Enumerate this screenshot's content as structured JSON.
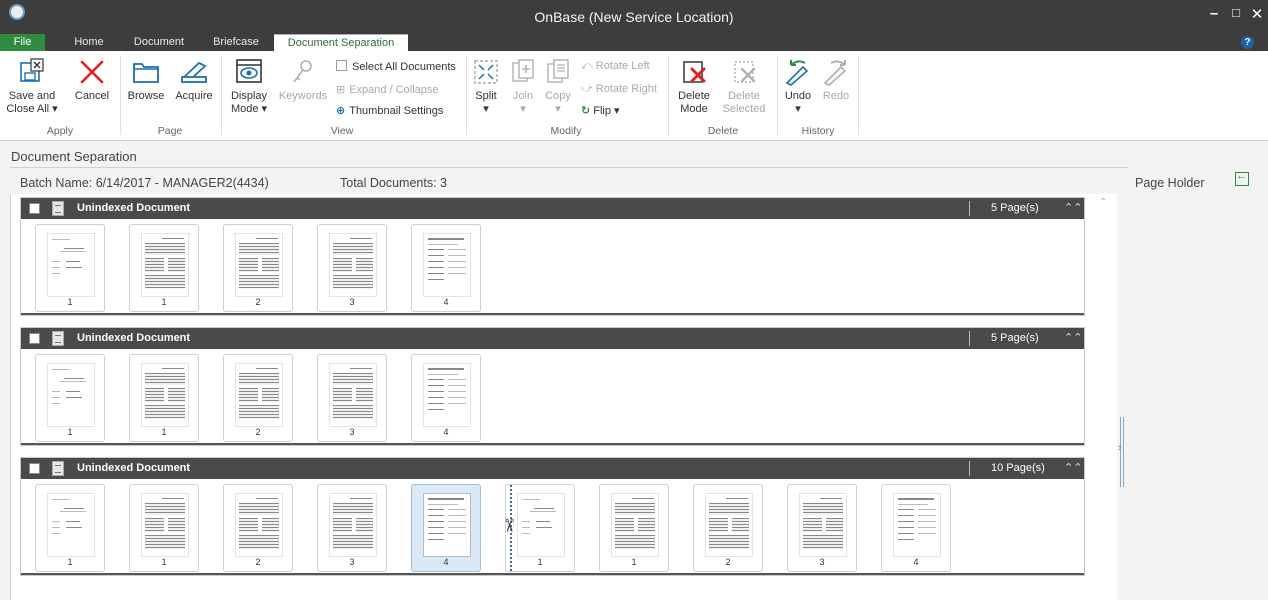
{
  "window": {
    "title": "OnBase (New Service Location)",
    "minimize": "–",
    "maximize": "□",
    "close": "✕",
    "help": "?"
  },
  "tabs": [
    {
      "label": "File"
    },
    {
      "label": "Home"
    },
    {
      "label": "Document"
    },
    {
      "label": "Briefcase"
    },
    {
      "label": "Document Separation"
    }
  ],
  "ribbon": {
    "apply": {
      "label": "Apply",
      "save_close_all": "Save and\nClose All ▾",
      "cancel": "Cancel"
    },
    "page": {
      "label": "Page",
      "browse": "Browse",
      "acquire": "Acquire"
    },
    "view": {
      "label": "View",
      "display_mode": "Display\nMode ▾",
      "keywords": "Keywords",
      "select_all": "Select All Documents",
      "expand_collapse": "Expand / Collapse",
      "thumbnail_settings": "Thumbnail Settings"
    },
    "modify": {
      "label": "Modify",
      "split": "Split\n▾",
      "join": "Join\n▾",
      "copy": "Copy\n▾",
      "rotate_left": "Rotate Left",
      "rotate_right": "Rotate Right",
      "flip": "Flip ▾"
    },
    "delete": {
      "label": "Delete",
      "delete_mode": "Delete\nMode",
      "delete_selected": "Delete\nSelected"
    },
    "history": {
      "label": "History",
      "undo": "Undo\n▾",
      "redo": "Redo"
    }
  },
  "main": {
    "section_title": "Document Separation",
    "batch_name": "Batch Name: 6/14/2017 - MANAGER2(4434)",
    "total_documents": "Total Documents: 3",
    "page_holder": "Page Holder"
  },
  "documents": [
    {
      "title": "Unindexed Document",
      "pages_label": "5 Page(s)",
      "thumbs": [
        "1",
        "1",
        "2",
        "3",
        "4"
      ]
    },
    {
      "title": "Unindexed Document",
      "pages_label": "5 Page(s)",
      "thumbs": [
        "1",
        "1",
        "2",
        "3",
        "4"
      ]
    },
    {
      "title": "Unindexed Document",
      "pages_label": "10 Page(s)",
      "thumbs": [
        "1",
        "1",
        "2",
        "3",
        "4",
        "1",
        "1",
        "2",
        "3",
        "4"
      ]
    }
  ],
  "colors": {
    "titlebar": "#3d3d3d",
    "file_tab": "#2e8b3f",
    "accent_blue": "#1e6fb5",
    "accent_red": "#e02020",
    "doc_header": "#4a4a4a"
  }
}
